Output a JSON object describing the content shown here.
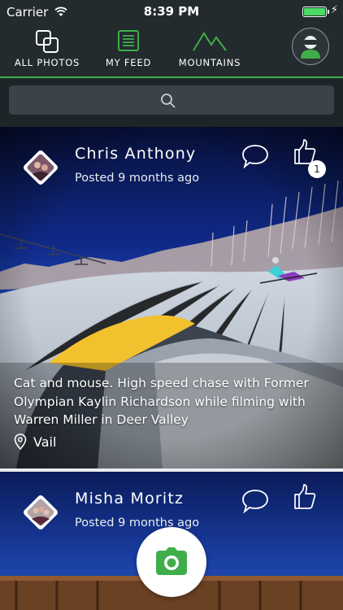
{
  "status_bar": {
    "carrier": "Carrier",
    "time": "8:39 PM"
  },
  "nav": {
    "tabs": [
      {
        "label": "ALL PHOTOS",
        "icon": "photos-icon"
      },
      {
        "label": "MY FEED",
        "icon": "feed-icon"
      },
      {
        "label": "MOUNTAINS",
        "icon": "mountains-icon"
      }
    ],
    "accent_color": "#3fae4a"
  },
  "search": {
    "icon": "search-icon"
  },
  "posts": [
    {
      "author": "Chris Anthony",
      "posted": "Posted 9 months ago",
      "like_count": "1",
      "caption": "Cat and mouse.  High speed chase with Former Olympian Kaylin Richardson while filming with Warren Miller in Deer Valley",
      "location": "Vail"
    },
    {
      "author": "Misha Moritz",
      "posted": "Posted 9 months ago"
    }
  ],
  "fab": {
    "icon": "camera-icon",
    "color": "#3fae4a"
  }
}
